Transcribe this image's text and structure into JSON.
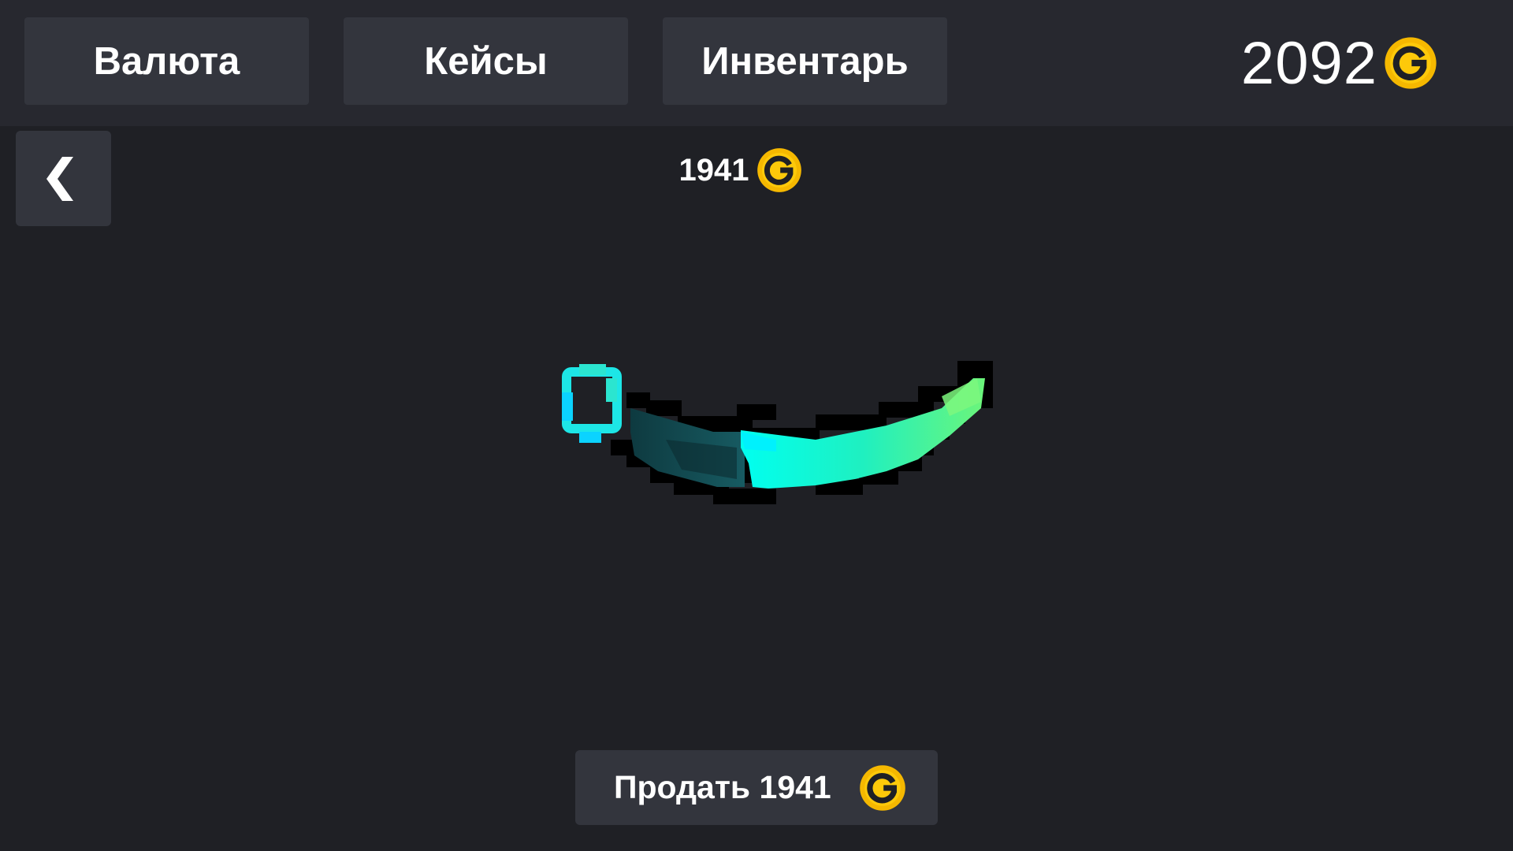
{
  "nav": {
    "currency_label": "Валюта",
    "cases_label": "Кейсы",
    "inventory_label": "Инвентарь"
  },
  "balance": {
    "value": "2092",
    "icon": "gold-coin-g-icon"
  },
  "back": {
    "icon": "chevron-left-icon"
  },
  "item": {
    "price": "1941",
    "icon": "gold-coin-g-icon",
    "image": "pixel-karambit-knife-cyan-green-gradient"
  },
  "sell": {
    "label": "Продать 1941",
    "icon": "gold-coin-g-icon"
  },
  "colors": {
    "background": "#1f2025",
    "topbar": "#27282f",
    "button": "#33353d",
    "coin": "#f5b800",
    "text": "#ffffff"
  }
}
